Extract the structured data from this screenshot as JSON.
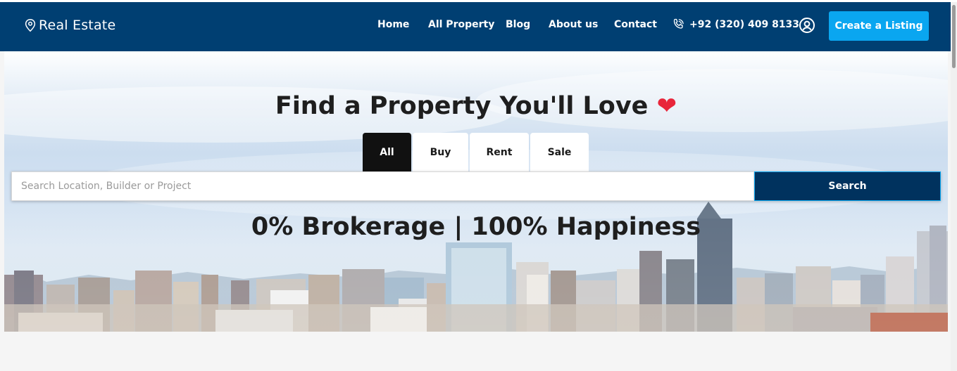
{
  "navbar": {
    "logo_text": "Real Estate",
    "links": [
      "Home",
      "All Property",
      "Blog",
      "About us",
      "Contact"
    ],
    "phone": "+92 (320) 409 8133",
    "cta_label": "Create a Listing"
  },
  "hero": {
    "title": "Find a Property You'll Love",
    "heart": "❤",
    "tabs": [
      "All",
      "Buy",
      "Rent",
      "Sale"
    ],
    "active_tab": "All",
    "search": {
      "placeholder": "Search Location, Builder or Project",
      "value": "",
      "button_label": "Search"
    },
    "tagline": "0% Brokerage | 100% Happiness"
  },
  "colors": {
    "navbar_bg": "#003f72",
    "cta_bg": "#0aa6f0",
    "search_button_bg": "#00325e",
    "heart": "#e8253a",
    "active_tab_bg": "#111111"
  },
  "icons": [
    "location-pin-icon",
    "phone-icon",
    "user-circle-icon"
  ]
}
